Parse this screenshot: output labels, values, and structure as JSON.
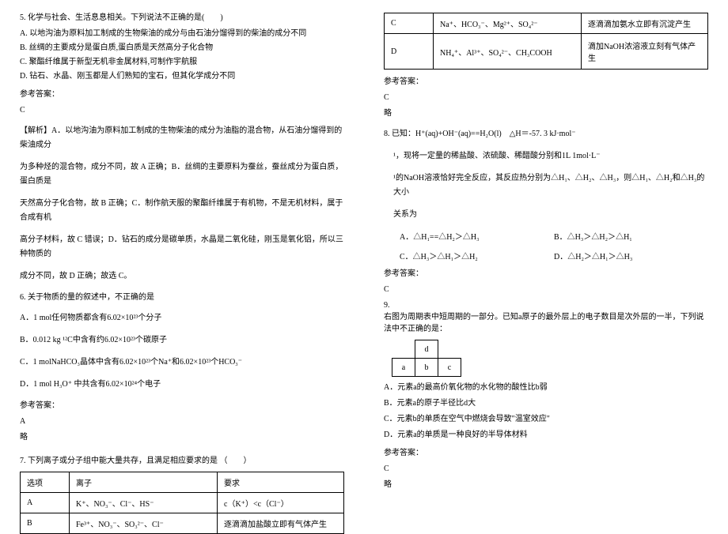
{
  "left": {
    "q5": {
      "stem": "5. 化学与社会、生活息息相关。下列说法不正确的是(　　)",
      "optA": "A. 以地沟油为原料加工制成的生物柴油的成分与由石油分馏得到的柴油的成分不同",
      "optB": "B. 丝绸的主要成分是蛋白质,蛋白质是天然高分子化合物",
      "optC": "C. 聚酯纤维属于新型无机非金属材料,可制作宇航服",
      "optD": "D. 钻石、水晶、刚玉都是人们熟知的宝石，但其化学成分不同",
      "ansLabel": "参考答案：",
      "ans": "C",
      "expl1": "【解析】A．以地沟油为原料加工制成的生物柴油的成分为油脂的混合物，从石油分馏得到的柴油成分",
      "expl2": "为多种烃的混合物，成分不同，故 A 正确；B．丝绸的主要原料为蚕丝，蚕丝成分为蛋白质，蛋白质是",
      "expl3": "天然高分子化合物，故 B 正确；C．制作航天服的聚酯纤维属于有机物，不是无机材料，属于合成有机",
      "expl4": "高分子材料，故 C 错误；D．钻石的成分是碳单质，水晶是二氧化硅，刚玉是氧化铝，所以三种物质的",
      "expl5": "成分不同，故 D 正确；故选 C。"
    },
    "q6": {
      "stem": "6. 关于物质的量的叙述中，不正确的是",
      "optA": "A．1 mol任何物质都含有6.02×10²³个分子",
      "optB": "B．0.012 kg ¹²C中含有约6.02×10²³个碳原子",
      "optC": "C．1 molNaHCO₃晶体中含有6.02×10²³个Na⁺和6.02×10²³个HCO₃⁻",
      "optD": "D．1 mol H₃O⁺ 中共含有6.02×10²⁴个电子",
      "ansLabel": "参考答案：",
      "ans": "A",
      "note": "略"
    },
    "q7": {
      "stem": "7. 下列离子或分子组中能大量共存，且满足相应要求的是 （　　）",
      "th1": "选项",
      "th2": "离子",
      "th3": "要求",
      "rA1": "A",
      "rA2": "K⁺、NO₃⁻、Cl⁻、HS⁻",
      "rA3": "c（K⁺）<c（Cl⁻）",
      "rB1": "B",
      "rB2": "Fe³⁺、NO₃⁻、SO₃²⁻、Cl⁻",
      "rB3": "逐滴滴加盐酸立即有气体产生"
    }
  },
  "right": {
    "q7cont": {
      "rC1": "C",
      "rC2": "Na⁺、HCO₃⁻、Mg²⁺、SO₄²⁻",
      "rC3": "逐滴滴加氨水立即有沉淀产生",
      "rD1": "D",
      "rD2": "NH₄⁺、Al³⁺、SO₄²⁻、CH₃COOH",
      "rD3": "滴加NaOH浓溶液立刻有气体产生",
      "ansLabel": "参考答案：",
      "ans": "C",
      "note": "略"
    },
    "q8": {
      "stem1": "8. 已知：H⁺(aq)+OH⁻(aq)==H₂O(l)　△H＝-57. 3 kJ·mol⁻",
      "stem2": "¹，现将一定量的稀盐酸、浓硫酸、稀醋酸分别和1L 1mol·L⁻",
      "stem3": "¹的NaOH溶液恰好完全反应，其反应热分别为△H₁、△H₂、△H₃，则△H₁、△H₂和△H₃的大小",
      "stem4": "关系为",
      "optA": "A．△H₁==△H₂＞△H₃",
      "optB": "B．△H₃＞△H₂＞△H₁",
      "optC": "C．△H₃＞△H₁＞△H₂",
      "optD": "D．△H₂＞△H₁＞△H₃",
      "ansLabel": "参考答案：",
      "ans": "C"
    },
    "q9": {
      "num": "9.",
      "stem": "右图为周期表中短周期的一部分。已知a原子的最外层上的电子数目是次外层的一半，下列说法中不正确的是：",
      "cellD": "d",
      "cellA": "a",
      "cellB": "b",
      "cellC": "c",
      "optA": "A．元素a的最高价氧化物的水化物的酸性比b弱",
      "optB": "B．元素a的原子半径比d大",
      "optC": "C．元素b的单质在空气中燃烧会导致\"温室效应\"",
      "optD": "D．元素a的单质是一种良好的半导体材料",
      "ansLabel": "参考答案：",
      "ans": "C",
      "note": "略"
    }
  }
}
